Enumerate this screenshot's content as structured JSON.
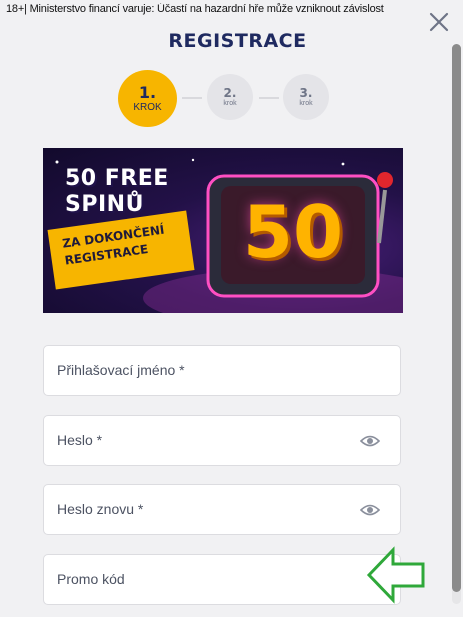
{
  "warning_text": "18+| Ministerstvo financí varuje: Účastí na hazardní hře může vzniknout závislost",
  "title": "REGISTRACE",
  "steps": [
    {
      "number": "1.",
      "label": "KROK",
      "active": true
    },
    {
      "number": "2.",
      "label": "krok",
      "active": false
    },
    {
      "number": "3.",
      "label": "krok",
      "active": false
    }
  ],
  "banner": {
    "headline_line1": "50 FREE",
    "headline_line2": "SPINŮ",
    "tag_line1": "ZA DOKONČENÍ",
    "tag_line2": "REGISTRACE",
    "big_number": "50"
  },
  "fields": {
    "username_placeholder": "Přihlašovací jméno *",
    "password_placeholder": "Heslo *",
    "password_repeat_placeholder": "Heslo znovu *",
    "promo_placeholder": "Promo kód"
  },
  "colors": {
    "accent": "#f7b500",
    "title": "#1f2a60",
    "annotation_arrow": "#2fa83a"
  },
  "icons": [
    "close-icon",
    "eye-icon",
    "arrow-left-icon"
  ]
}
